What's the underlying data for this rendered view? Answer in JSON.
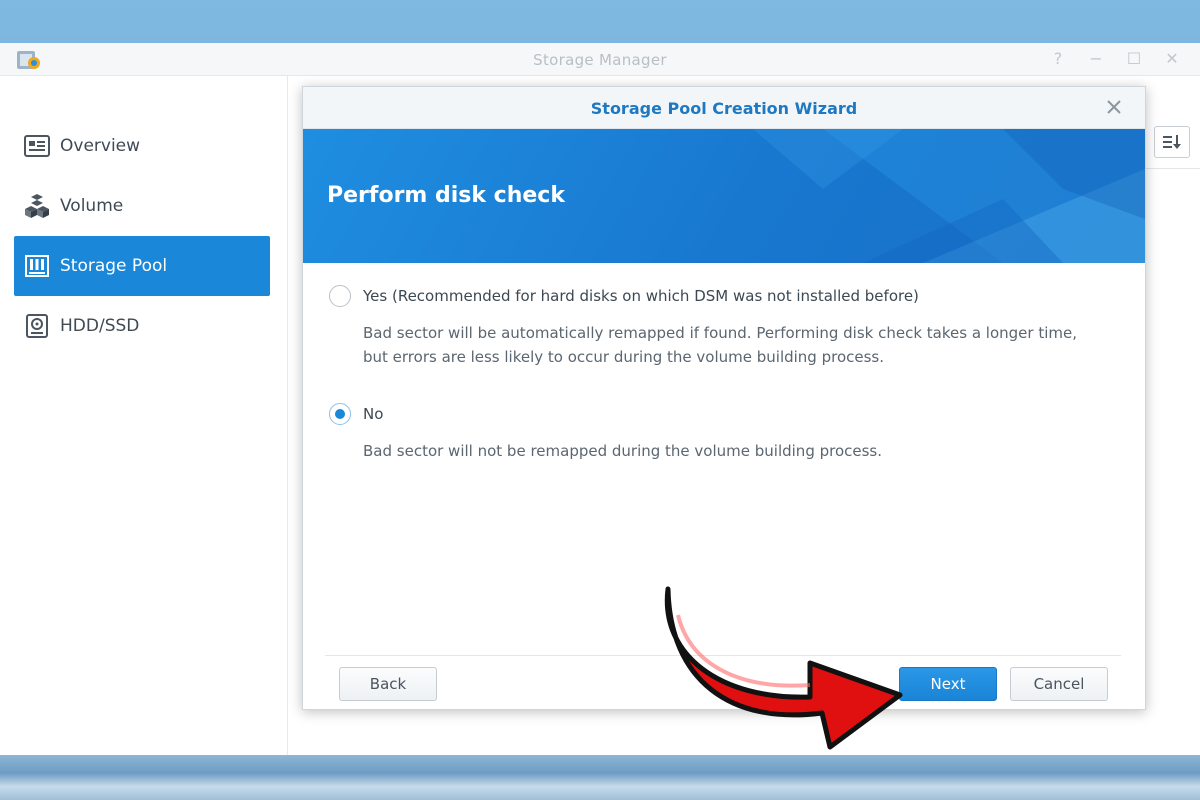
{
  "app": {
    "title": "Storage Manager",
    "controls": [
      "?",
      "−",
      "☐",
      "✕"
    ]
  },
  "sidebar": {
    "items": [
      {
        "label": "Overview",
        "icon": "overview-icon",
        "active": false
      },
      {
        "label": "Volume",
        "icon": "volume-icon",
        "active": false
      },
      {
        "label": "Storage Pool",
        "icon": "storage-pool-icon",
        "active": true
      },
      {
        "label": "HDD/SSD",
        "icon": "hdd-icon",
        "active": false
      }
    ]
  },
  "dialog": {
    "title": "Storage Pool Creation Wizard",
    "banner_title": "Perform disk check",
    "options": [
      {
        "label": "Yes (Recommended for hard disks on which DSM was not installed before)",
        "desc": "Bad sector will be automatically remapped if found. Performing disk check takes a longer time, but errors are less likely to occur during the volume building process.",
        "checked": false
      },
      {
        "label": "No",
        "desc": "Bad sector will not be remapped during the volume building process.",
        "checked": true
      }
    ],
    "buttons": {
      "back": "Back",
      "next": "Next",
      "cancel": "Cancel"
    }
  },
  "colors": {
    "accent": "#1a87d8",
    "title_blue": "#1e78c2",
    "arrow": "#e01010"
  }
}
